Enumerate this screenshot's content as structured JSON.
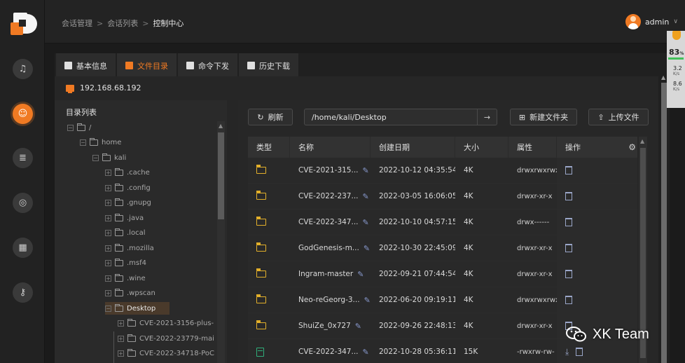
{
  "header": {
    "breadcrumb": [
      "会话管理",
      "会话列表",
      "控制中心"
    ],
    "separator": ">",
    "username": "admin",
    "dropdown_glyph": "∨"
  },
  "sidebar": {
    "icons": [
      "headset-icon",
      "smiley-icon",
      "document-icon",
      "radar-icon",
      "calendar-icon",
      "key-icon"
    ],
    "active_index": 1
  },
  "tabs": [
    {
      "label": "基本信息",
      "icon": "info-icon",
      "active": false
    },
    {
      "label": "文件目录",
      "icon": "folder-icon",
      "active": true
    },
    {
      "label": "命令下发",
      "icon": "terminal-icon",
      "active": false
    },
    {
      "label": "历史下载",
      "icon": "download-icon",
      "active": false
    }
  ],
  "host": {
    "ip": "192.168.68.192"
  },
  "tree": {
    "title": "目录列表",
    "nodes": [
      {
        "label": "/",
        "depth": 0,
        "toggle": "⊟",
        "selected": false
      },
      {
        "label": "home",
        "depth": 1,
        "toggle": "⊟",
        "selected": false
      },
      {
        "label": "kali",
        "depth": 2,
        "toggle": "⊟",
        "selected": false
      },
      {
        "label": ".cache",
        "depth": 3,
        "toggle": "⊞",
        "selected": false
      },
      {
        "label": ".config",
        "depth": 3,
        "toggle": "⊞",
        "selected": false
      },
      {
        "label": ".gnupg",
        "depth": 3,
        "toggle": "⊞",
        "selected": false
      },
      {
        "label": ".java",
        "depth": 3,
        "toggle": "⊞",
        "selected": false
      },
      {
        "label": ".local",
        "depth": 3,
        "toggle": "⊞",
        "selected": false
      },
      {
        "label": ".mozilla",
        "depth": 3,
        "toggle": "⊞",
        "selected": false
      },
      {
        "label": ".msf4",
        "depth": 3,
        "toggle": "⊞",
        "selected": false
      },
      {
        "label": ".wine",
        "depth": 3,
        "toggle": "⊞",
        "selected": false
      },
      {
        "label": ".wpscan",
        "depth": 3,
        "toggle": "⊞",
        "selected": false
      },
      {
        "label": "Desktop",
        "depth": 3,
        "toggle": "⊟",
        "selected": true
      },
      {
        "label": "CVE-2021-3156-plus-",
        "depth": 4,
        "toggle": "⊞",
        "selected": false
      },
      {
        "label": "CVE-2022-23779-mai",
        "depth": 4,
        "toggle": "⊞",
        "selected": false
      },
      {
        "label": "CVE-2022-34718-PoC",
        "depth": 4,
        "toggle": "⊞",
        "selected": false
      }
    ]
  },
  "toolbar": {
    "refresh_label": "刷新",
    "path_value": "/home/kali/Desktop",
    "go_glyph": "→",
    "new_folder_label": "新建文件夹",
    "upload_label": "上传文件"
  },
  "table": {
    "columns": [
      "类型",
      "名称",
      "创建日期",
      "大小",
      "属性",
      "操作"
    ],
    "rows": [
      {
        "type": "folder",
        "name": "CVE-2021-315...",
        "date": "2022-10-12 04:35:54",
        "size": "4K",
        "attr": "drwxrwxrwx"
      },
      {
        "type": "folder",
        "name": "CVE-2022-237...",
        "date": "2022-03-05 16:06:05",
        "size": "4K",
        "attr": "drwxr-xr-x"
      },
      {
        "type": "folder",
        "name": "CVE-2022-347...",
        "date": "2022-10-10 04:57:15",
        "size": "4K",
        "attr": "drwx------"
      },
      {
        "type": "folder",
        "name": "GodGenesis-m...",
        "date": "2022-10-30 22:45:09",
        "size": "4K",
        "attr": "drwxr-xr-x"
      },
      {
        "type": "folder",
        "name": "Ingram-master",
        "date": "2022-09-21 07:44:54",
        "size": "4K",
        "attr": "drwxr-xr-x"
      },
      {
        "type": "folder",
        "name": "Neo-reGeorg-3...",
        "date": "2022-06-20 09:19:11",
        "size": "4K",
        "attr": "drwxrwxrwx"
      },
      {
        "type": "folder",
        "name": "ShuiZe_0x727",
        "date": "2022-09-26 22:48:13",
        "size": "4K",
        "attr": "drwxr-xr-x"
      },
      {
        "type": "file",
        "name": "CVE-2022-347...",
        "date": "2022-10-28 05:36:11",
        "size": "15K",
        "attr": "-rwxrw-rw-"
      }
    ]
  },
  "monitor": {
    "cpu": "83",
    "cpu_unit": "%",
    "up_speed": "3.2",
    "down_speed": "8.6",
    "speed_unit": "K/s",
    "bar_color": "#42c05a"
  },
  "watermark": {
    "text": "XK Team"
  },
  "colors": {
    "accent": "#f07a23",
    "folder": "#e3b02a",
    "file": "#2fae7a"
  }
}
